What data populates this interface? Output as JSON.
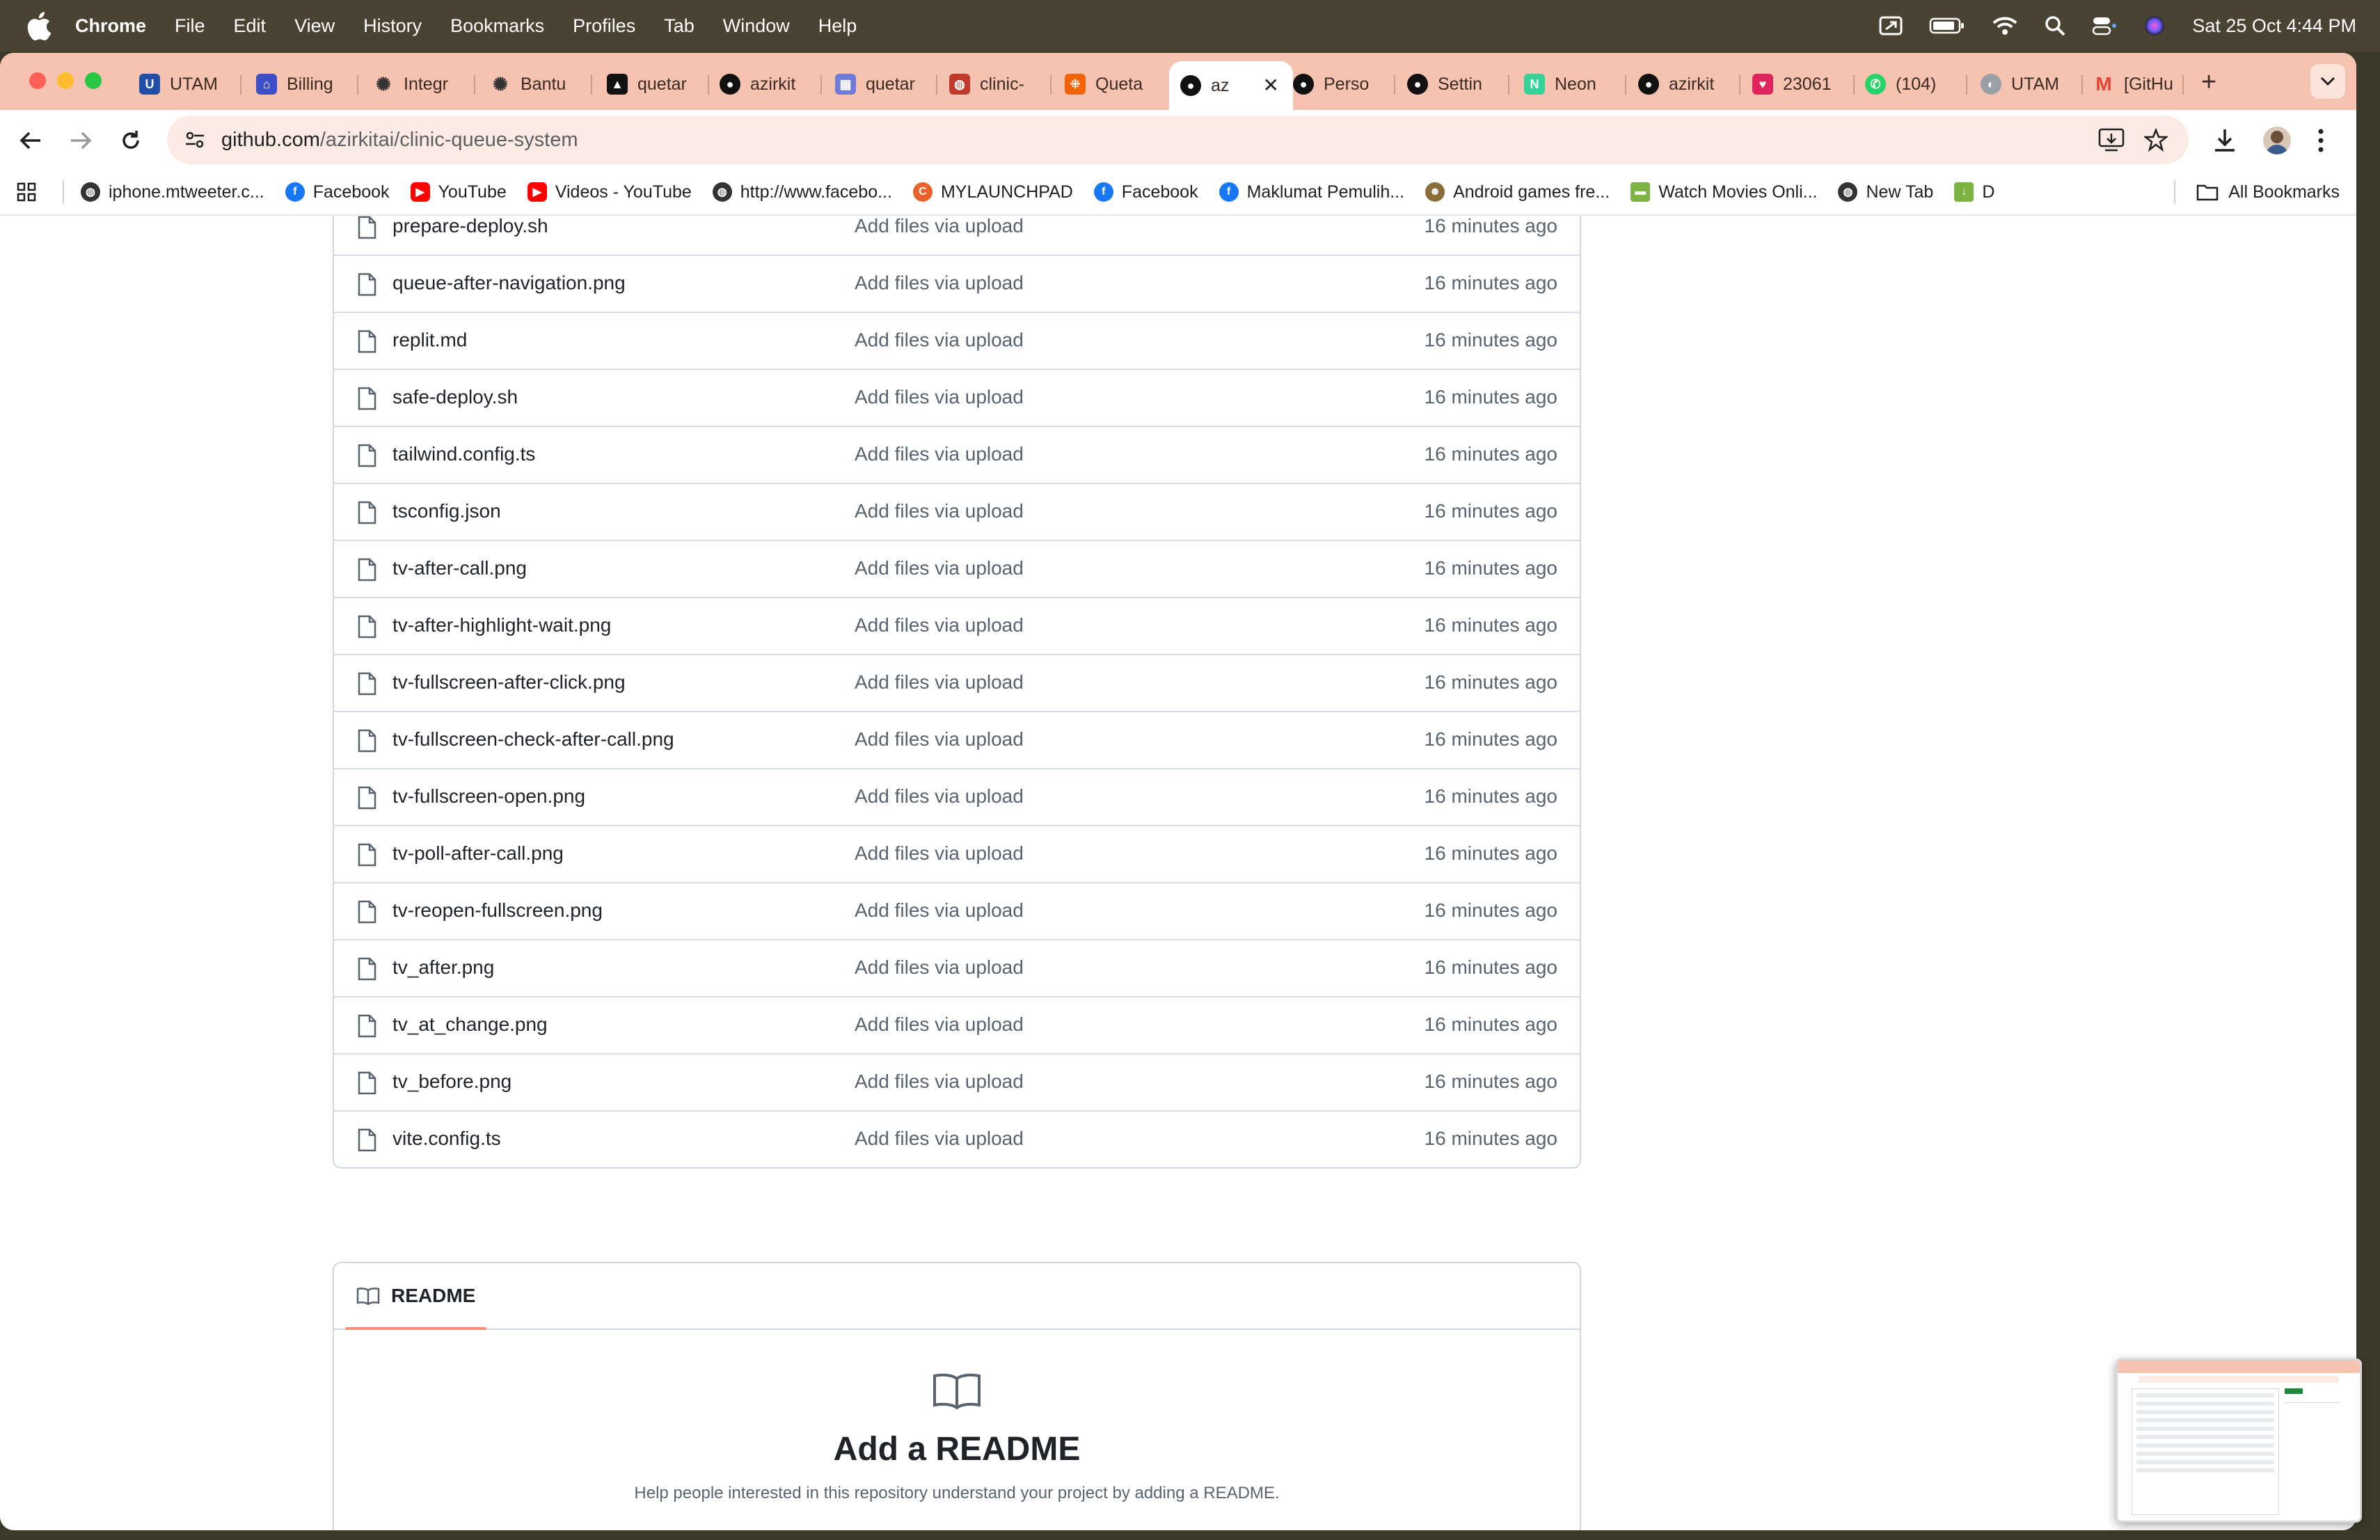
{
  "menubar": {
    "app_name": "Chrome",
    "items": [
      "File",
      "Edit",
      "View",
      "History",
      "Bookmarks",
      "Profiles",
      "Tab",
      "Window",
      "Help"
    ],
    "datetime": "Sat 25 Oct  4:44 PM"
  },
  "tabs": [
    {
      "label": "UTAM",
      "icon": "utam-icon",
      "color": "#1f4fa8"
    },
    {
      "label": "Billing",
      "icon": "billing-icon",
      "color": "#3d4fc8"
    },
    {
      "label": "Integr",
      "icon": "openai-icon",
      "color": "#333333"
    },
    {
      "label": "Bantu",
      "icon": "openai-icon",
      "color": "#333333"
    },
    {
      "label": "quetar",
      "icon": "vercel-icon",
      "color": "#111111"
    },
    {
      "label": "azirkit",
      "icon": "github-icon",
      "color": "#111111"
    },
    {
      "label": "quetar",
      "icon": "table-icon",
      "color": "#6e7bd8"
    },
    {
      "label": "clinic-",
      "icon": "database-icon",
      "color": "#c0392b"
    },
    {
      "label": "Queta",
      "icon": "replit-icon",
      "color": "#f26207"
    },
    {
      "label": "az",
      "icon": "github-icon",
      "color": "#111111",
      "active": true
    },
    {
      "label": "Perso",
      "icon": "github-icon",
      "color": "#111111"
    },
    {
      "label": "Settin",
      "icon": "github-icon",
      "color": "#111111"
    },
    {
      "label": "Neon",
      "icon": "neon-icon",
      "color": "#34d399"
    },
    {
      "label": "azirkit",
      "icon": "github-icon",
      "color": "#111111"
    },
    {
      "label": "23061",
      "icon": "heart-icon",
      "color": "#e0245e"
    },
    {
      "label": "(104)",
      "icon": "whatsapp-icon",
      "color": "#25d366"
    },
    {
      "label": "UTAM",
      "icon": "globe-icon",
      "color": "#9aa0a6"
    },
    {
      "label": "[GitHu",
      "icon": "gmail-icon",
      "color": "#ea4335"
    }
  ],
  "url": {
    "domain": "github.com",
    "path": "/azirkitai/clinic-queue-system"
  },
  "bookmarks": [
    {
      "label": "iphone.mtweeter.c...",
      "icon": "globe-icon",
      "color": "#333333"
    },
    {
      "label": "Facebook",
      "icon": "facebook-icon",
      "color": "#1877f2"
    },
    {
      "label": "YouTube",
      "icon": "youtube-icon",
      "color": "#ff0000"
    },
    {
      "label": "Videos - YouTube",
      "icon": "youtube-icon",
      "color": "#ff0000"
    },
    {
      "label": "http://www.facebo...",
      "icon": "globe-icon",
      "color": "#333333"
    },
    {
      "label": "MYLAUNCHPAD",
      "icon": "launchpad-icon",
      "color": "#e8632b"
    },
    {
      "label": "Facebook",
      "icon": "facebook-icon",
      "color": "#1877f2"
    },
    {
      "label": "Maklumat Pemulih...",
      "icon": "facebook-icon",
      "color": "#1877f2"
    },
    {
      "label": "Android games fre...",
      "icon": "android-games-icon",
      "color": "#8a6d3b"
    },
    {
      "label": "Watch Movies Onli...",
      "icon": "movies-icon",
      "color": "#7cb342"
    },
    {
      "label": "New Tab",
      "icon": "globe-icon",
      "color": "#333333"
    },
    {
      "label": "D",
      "icon": "download-bookmark-icon",
      "color": "#7cb342"
    }
  ],
  "all_bookmarks_label": "All Bookmarks",
  "files": [
    {
      "name": "prepare-deploy.sh",
      "message": "Add files via upload",
      "time": "16 minutes ago"
    },
    {
      "name": "queue-after-navigation.png",
      "message": "Add files via upload",
      "time": "16 minutes ago"
    },
    {
      "name": "replit.md",
      "message": "Add files via upload",
      "time": "16 minutes ago"
    },
    {
      "name": "safe-deploy.sh",
      "message": "Add files via upload",
      "time": "16 minutes ago"
    },
    {
      "name": "tailwind.config.ts",
      "message": "Add files via upload",
      "time": "16 minutes ago"
    },
    {
      "name": "tsconfig.json",
      "message": "Add files via upload",
      "time": "16 minutes ago"
    },
    {
      "name": "tv-after-call.png",
      "message": "Add files via upload",
      "time": "16 minutes ago"
    },
    {
      "name": "tv-after-highlight-wait.png",
      "message": "Add files via upload",
      "time": "16 minutes ago"
    },
    {
      "name": "tv-fullscreen-after-click.png",
      "message": "Add files via upload",
      "time": "16 minutes ago"
    },
    {
      "name": "tv-fullscreen-check-after-call.png",
      "message": "Add files via upload",
      "time": "16 minutes ago"
    },
    {
      "name": "tv-fullscreen-open.png",
      "message": "Add files via upload",
      "time": "16 minutes ago"
    },
    {
      "name": "tv-poll-after-call.png",
      "message": "Add files via upload",
      "time": "16 minutes ago"
    },
    {
      "name": "tv-reopen-fullscreen.png",
      "message": "Add files via upload",
      "time": "16 minutes ago"
    },
    {
      "name": "tv_after.png",
      "message": "Add files via upload",
      "time": "16 minutes ago"
    },
    {
      "name": "tv_at_change.png",
      "message": "Add files via upload",
      "time": "16 minutes ago"
    },
    {
      "name": "tv_before.png",
      "message": "Add files via upload",
      "time": "16 minutes ago"
    },
    {
      "name": "vite.config.ts",
      "message": "Add files via upload",
      "time": "16 minutes ago"
    }
  ],
  "readme": {
    "tab_label": "README",
    "title": "Add a README",
    "description": "Help people interested in this repository understand your project by adding a README."
  }
}
